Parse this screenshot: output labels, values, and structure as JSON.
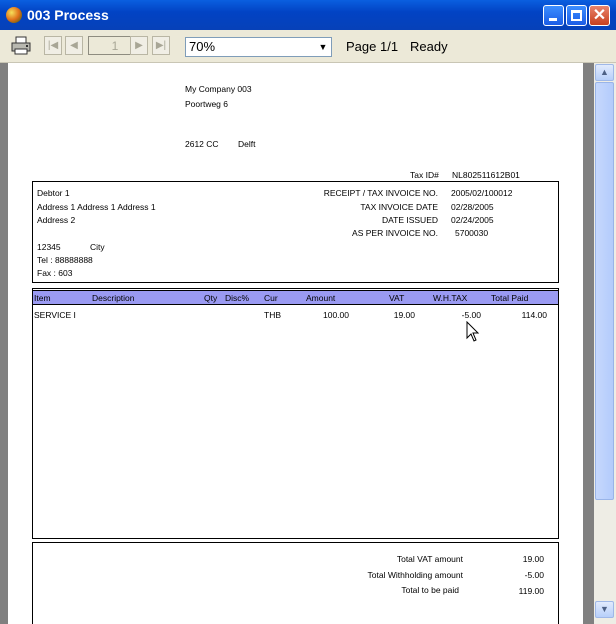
{
  "window": {
    "title": "003 Process"
  },
  "toolbar": {
    "page_number": "1",
    "zoom": "70%",
    "page_status": "Page 1/1",
    "ready_status": "Ready"
  },
  "company": {
    "name": "My Company 003",
    "street": "Poortweg 6",
    "postal": "2612 CC",
    "city": "Delft",
    "tax_id_label": "Tax ID#",
    "tax_id": "NL802511612B01"
  },
  "debtor": {
    "name": "Debtor 1",
    "address1": "Address 1 Address 1 Address 1",
    "address2": "Address 2",
    "postal": "12345",
    "city": "City",
    "tel": "Tel  :  88888888",
    "fax": "Fax :  603"
  },
  "receipt": {
    "no_label": "RECEIPT / TAX INVOICE NO.",
    "no_value": "2005/02/100012",
    "date_label": "TAX INVOICE DATE",
    "date_value": "02/28/2005",
    "issued_label": "DATE ISSUED",
    "issued_value": "02/24/2005",
    "per_invoice_label": "AS PER INVOICE NO.",
    "per_invoice_value": "5700030"
  },
  "table": {
    "columns": {
      "item": "Item",
      "description": "Description",
      "qty": "Qty",
      "disc": "Disc%",
      "cur": "Cur",
      "amount": "Amount",
      "vat": "VAT",
      "wh_tax": "W.H.TAX",
      "total_paid": "Total Paid"
    },
    "rows": [
      {
        "item": "SERVICE I",
        "cur": "THB",
        "amount": "100.00",
        "vat": "19.00",
        "wh_tax": "-5.00",
        "total_paid": "114.00"
      }
    ]
  },
  "totals": {
    "vat_label": "Total VAT amount",
    "vat_value": "19.00",
    "withholding_label": "Total Withholding amount",
    "withholding_value": "-5.00",
    "to_pay_label": "Total to be paid",
    "to_pay_value": "119.00"
  },
  "icons": [
    "app-icon",
    "minimize-icon",
    "maximize-icon",
    "close-icon",
    "printer-icon",
    "first-page-icon",
    "prev-page-icon",
    "next-page-icon",
    "last-page-icon",
    "dropdown-arrow-icon",
    "scroll-up-icon",
    "scroll-down-icon",
    "mouse-cursor-icon"
  ]
}
